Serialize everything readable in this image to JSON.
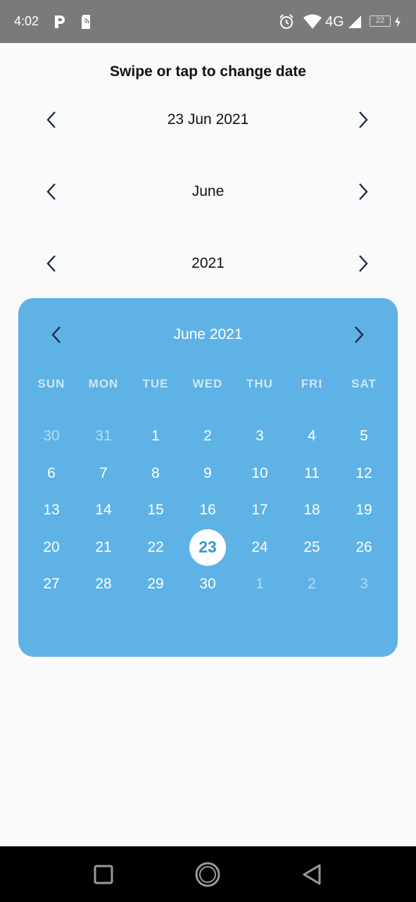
{
  "status_bar": {
    "time": "4:02",
    "network": "4G",
    "battery": "22",
    "icons": [
      "parking-icon",
      "nfc-card-icon",
      "alarm-icon",
      "wifi-icon",
      "signal-icon",
      "battery-icon",
      "charging-icon"
    ]
  },
  "header": {
    "title": "Swipe or tap to change date"
  },
  "selectors": {
    "date": {
      "value": "23 Jun 2021"
    },
    "month": {
      "value": "June"
    },
    "year": {
      "value": "2021"
    }
  },
  "calendar": {
    "title": "June 2021",
    "background": "#5eb2e5",
    "weekdays": [
      "SUN",
      "MON",
      "TUE",
      "WED",
      "THU",
      "FRI",
      "SAT"
    ],
    "days": [
      {
        "label": "30",
        "muted": true
      },
      {
        "label": "31",
        "muted": true
      },
      {
        "label": "1"
      },
      {
        "label": "2"
      },
      {
        "label": "3"
      },
      {
        "label": "4"
      },
      {
        "label": "5"
      },
      {
        "label": "6"
      },
      {
        "label": "7"
      },
      {
        "label": "8"
      },
      {
        "label": "9"
      },
      {
        "label": "10"
      },
      {
        "label": "11"
      },
      {
        "label": "12"
      },
      {
        "label": "13"
      },
      {
        "label": "14"
      },
      {
        "label": "15"
      },
      {
        "label": "16"
      },
      {
        "label": "17"
      },
      {
        "label": "18"
      },
      {
        "label": "19"
      },
      {
        "label": "20"
      },
      {
        "label": "21"
      },
      {
        "label": "22"
      },
      {
        "label": "23",
        "selected": true
      },
      {
        "label": "24"
      },
      {
        "label": "25"
      },
      {
        "label": "26"
      },
      {
        "label": "27"
      },
      {
        "label": "28"
      },
      {
        "label": "29"
      },
      {
        "label": "30"
      },
      {
        "label": "1",
        "muted": true
      },
      {
        "label": "2",
        "muted": true
      },
      {
        "label": "3",
        "muted": true
      }
    ]
  },
  "system_nav": {
    "icons": [
      "recents-square-icon",
      "home-circle-icon",
      "back-triangle-icon"
    ]
  }
}
